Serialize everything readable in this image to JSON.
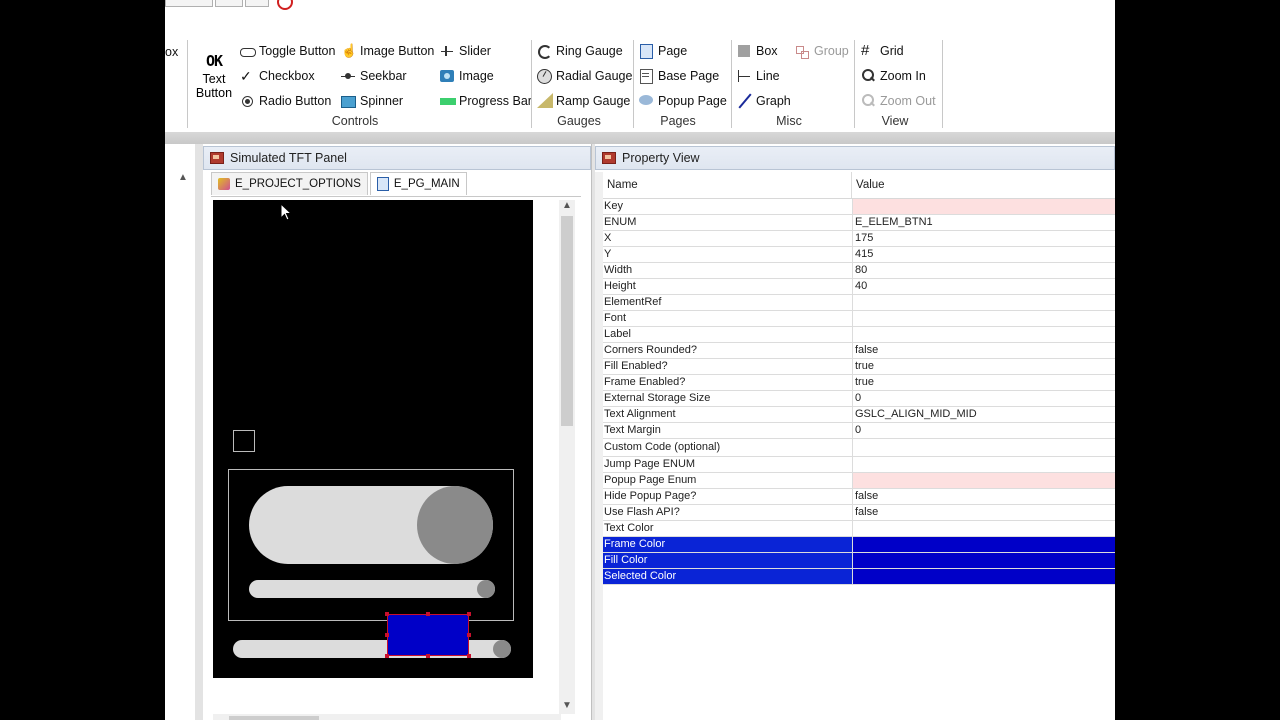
{
  "ribbon": {
    "partial_left": "ox",
    "big_button": {
      "icon_text": "OK",
      "label": "Text Button"
    },
    "controls": {
      "toggle_button": "Toggle Button",
      "image_button": "Image Button",
      "slider": "Slider",
      "checkbox": "Checkbox",
      "seekbar": "Seekbar",
      "image": "Image",
      "radio_button": "Radio Button",
      "spinner": "Spinner",
      "progress_bar": "Progress Bar",
      "group_label": "Controls"
    },
    "gauges": {
      "ring_gauge": "Ring Gauge",
      "radial_gauge": "Radial Gauge",
      "ramp_gauge": "Ramp Gauge",
      "group_label": "Gauges"
    },
    "pages": {
      "page": "Page",
      "base_page": "Base Page",
      "popup_page": "Popup Page",
      "group_label": "Pages"
    },
    "misc": {
      "box": "Box",
      "group": "Group",
      "line": "Line",
      "graph": "Graph",
      "group_label": "Misc"
    },
    "view": {
      "grid": "Grid",
      "zoom_in": "Zoom In",
      "zoom_out": "Zoom Out",
      "group_label": "View"
    }
  },
  "tft_panel": {
    "title": "Simulated TFT Panel",
    "tabs": [
      {
        "label": "E_PROJECT_OPTIONS"
      },
      {
        "label": "E_PG_MAIN"
      }
    ]
  },
  "property_view": {
    "title": "Property View",
    "headers": {
      "name": "Name",
      "value": "Value"
    },
    "rows": [
      {
        "name": "Key",
        "value": ""
      },
      {
        "name": "ENUM",
        "value": "E_ELEM_BTN1"
      },
      {
        "name": "X",
        "value": "175"
      },
      {
        "name": "Y",
        "value": "415"
      },
      {
        "name": "Width",
        "value": "80"
      },
      {
        "name": "Height",
        "value": "40"
      },
      {
        "name": "ElementRef",
        "value": ""
      },
      {
        "name": "Font",
        "value": ""
      },
      {
        "name": "Label",
        "value": ""
      },
      {
        "name": "Corners Rounded?",
        "value": "false"
      },
      {
        "name": "Fill Enabled?",
        "value": "true"
      },
      {
        "name": "Frame Enabled?",
        "value": "true"
      },
      {
        "name": "External Storage Size",
        "value": "0"
      },
      {
        "name": "Text Alignment",
        "value": "GSLC_ALIGN_MID_MID"
      },
      {
        "name": "Text Margin",
        "value": "0"
      },
      {
        "name": "Custom Code (optional)",
        "value": ""
      },
      {
        "name": "Jump Page ENUM",
        "value": ""
      },
      {
        "name": "Popup Page Enum",
        "value": ""
      },
      {
        "name": "Hide Popup Page?",
        "value": "false"
      },
      {
        "name": "Use Flash API?",
        "value": "false"
      },
      {
        "name": "Text Color",
        "value": ""
      },
      {
        "name": "Frame Color",
        "value": ""
      },
      {
        "name": "Fill Color",
        "value": ""
      },
      {
        "name": "Selected Color",
        "value": ""
      }
    ]
  },
  "colors": {
    "selection": "#0a24d6",
    "button_fill": "#0000c8",
    "handle": "#c8102e"
  }
}
